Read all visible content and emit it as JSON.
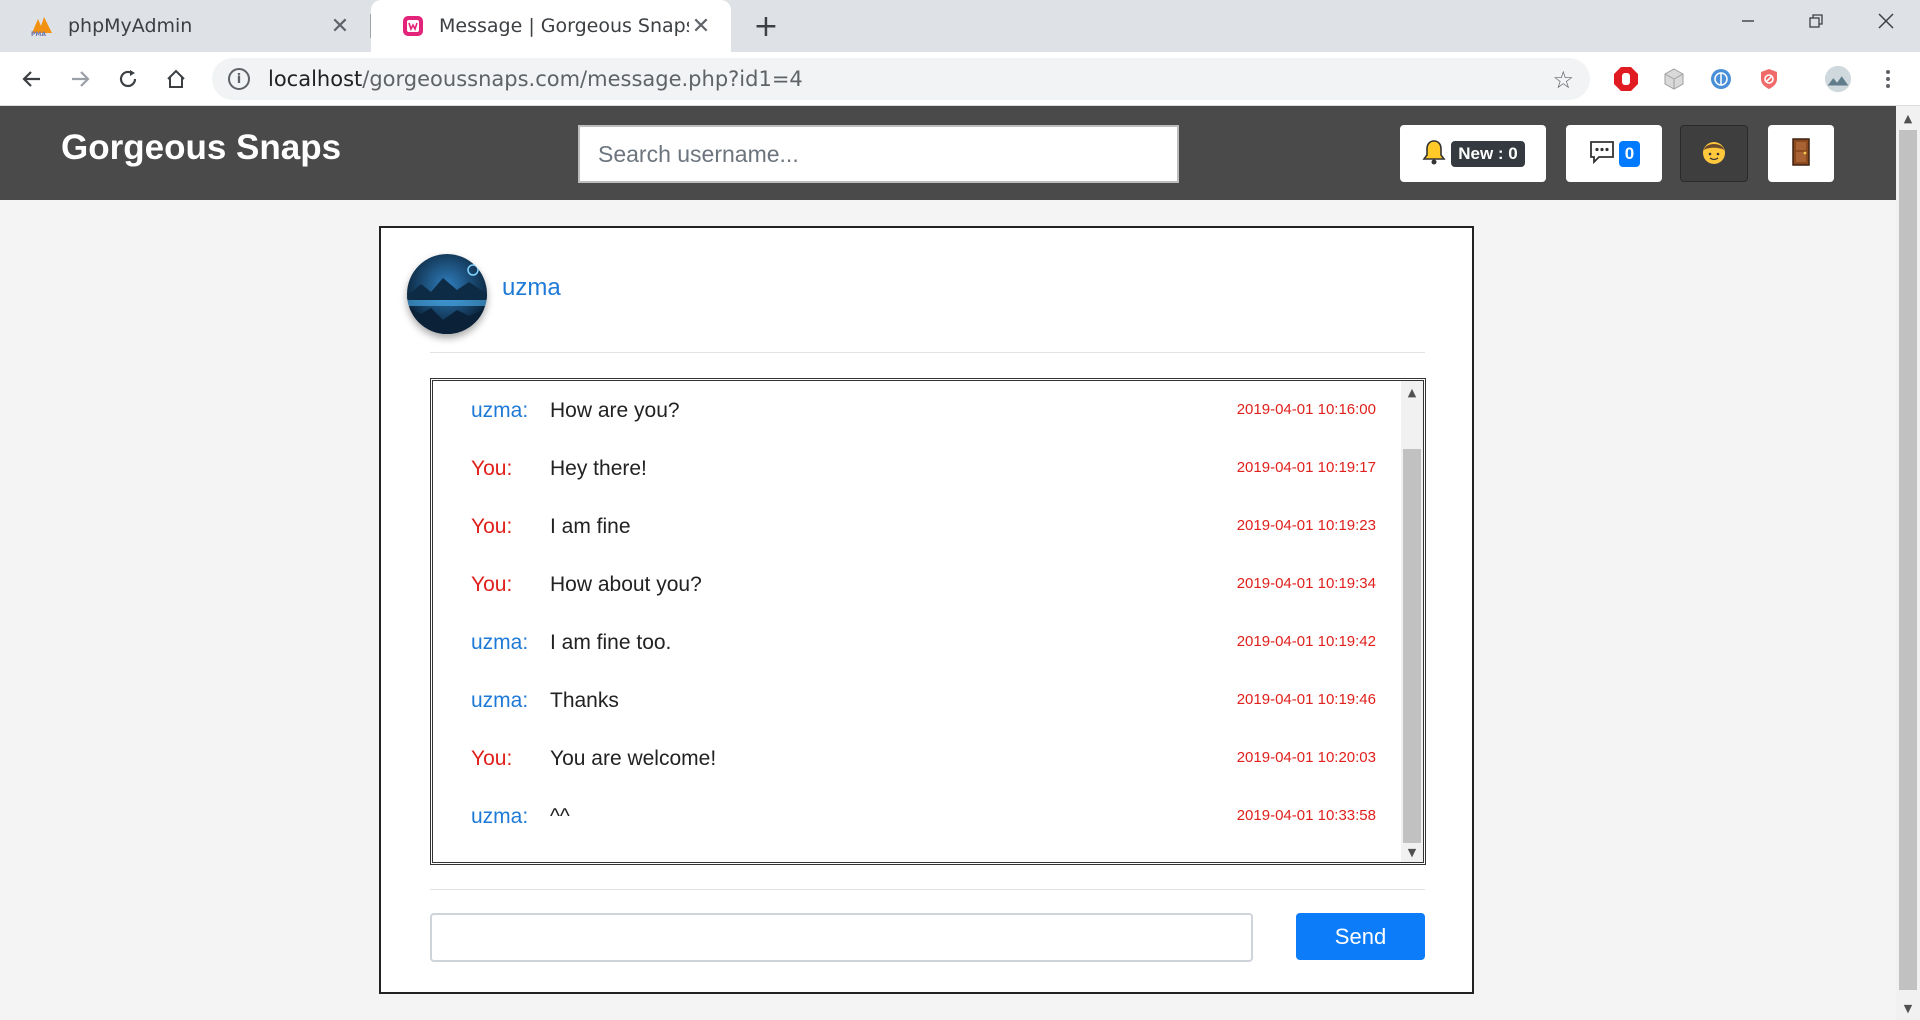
{
  "browser": {
    "tabs": [
      {
        "title": "phpMyAdmin",
        "favicon": "phpmyadmin-icon"
      },
      {
        "title": "Message | Gorgeous Snaps",
        "favicon": "wamp-icon"
      }
    ],
    "url_host": "localhost",
    "url_path": "/gorgeoussnaps.com/message.php?id1=4"
  },
  "header": {
    "brand": "Gorgeous Snaps",
    "search_placeholder": "Search username...",
    "notifications_badge": "New : 0",
    "messages_badge": "0"
  },
  "conversation": {
    "contact_name": "uzma",
    "messages": [
      {
        "sender": "uzma:",
        "is_me": false,
        "text": "How are you?",
        "time": "2019-04-01 10:16:00"
      },
      {
        "sender": "You:",
        "is_me": true,
        "text": "Hey there!",
        "time": "2019-04-01 10:19:17"
      },
      {
        "sender": "You:",
        "is_me": true,
        "text": "I am fine",
        "time": "2019-04-01 10:19:23"
      },
      {
        "sender": "You:",
        "is_me": true,
        "text": "How about you?",
        "time": "2019-04-01 10:19:34"
      },
      {
        "sender": "uzma:",
        "is_me": false,
        "text": "I am fine too.",
        "time": "2019-04-01 10:19:42"
      },
      {
        "sender": "uzma:",
        "is_me": false,
        "text": "Thanks",
        "time": "2019-04-01 10:19:46"
      },
      {
        "sender": "You:",
        "is_me": true,
        "text": "You are welcome!",
        "time": "2019-04-01 10:20:03"
      },
      {
        "sender": "uzma:",
        "is_me": false,
        "text": "^^",
        "time": "2019-04-01 10:33:58"
      }
    ],
    "compose_value": "",
    "send_label": "Send"
  },
  "colors": {
    "header_bg": "#4a4a4a",
    "contact_blue": "#1e7ad6",
    "self_red": "#e0201c",
    "send_button": "#0d7cf9"
  }
}
